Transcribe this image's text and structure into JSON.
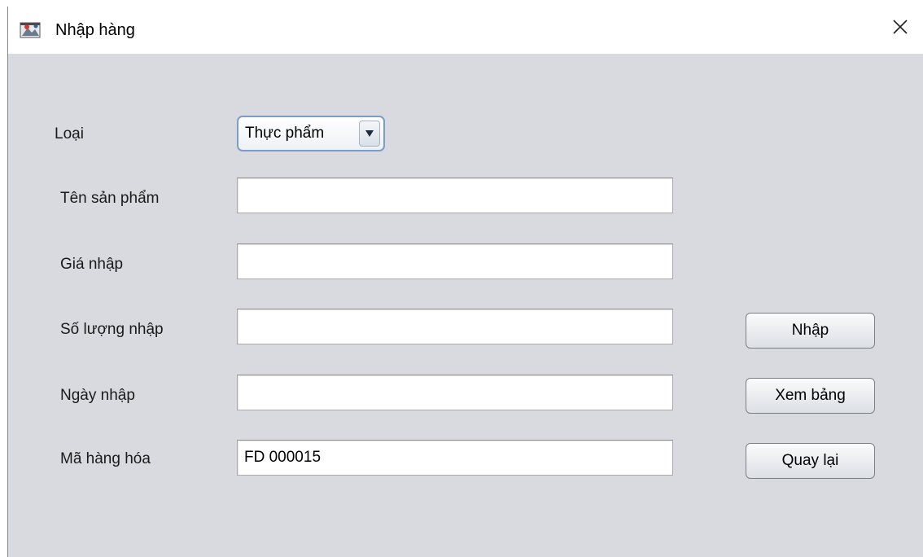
{
  "window": {
    "title": "Nhập hàng",
    "close_icon": "close-icon"
  },
  "form": {
    "category": {
      "label": "Loại",
      "selected": "Thực phẩm"
    },
    "product_name": {
      "label": "Tên sản phẩm",
      "value": ""
    },
    "import_price": {
      "label": "Giá nhập",
      "value": ""
    },
    "import_quantity": {
      "label": "Số lượng nhập",
      "value": ""
    },
    "import_date": {
      "label": "Ngày nhập",
      "value": ""
    },
    "product_code": {
      "label": "Mã hàng hóa",
      "value": "FD 000015"
    }
  },
  "buttons": {
    "import": "Nhập",
    "view_table": "Xem bảng",
    "back": "Quay lại"
  },
  "colors": {
    "panel_background": "#d8dae0",
    "combo_border": "#7b9ec9"
  }
}
